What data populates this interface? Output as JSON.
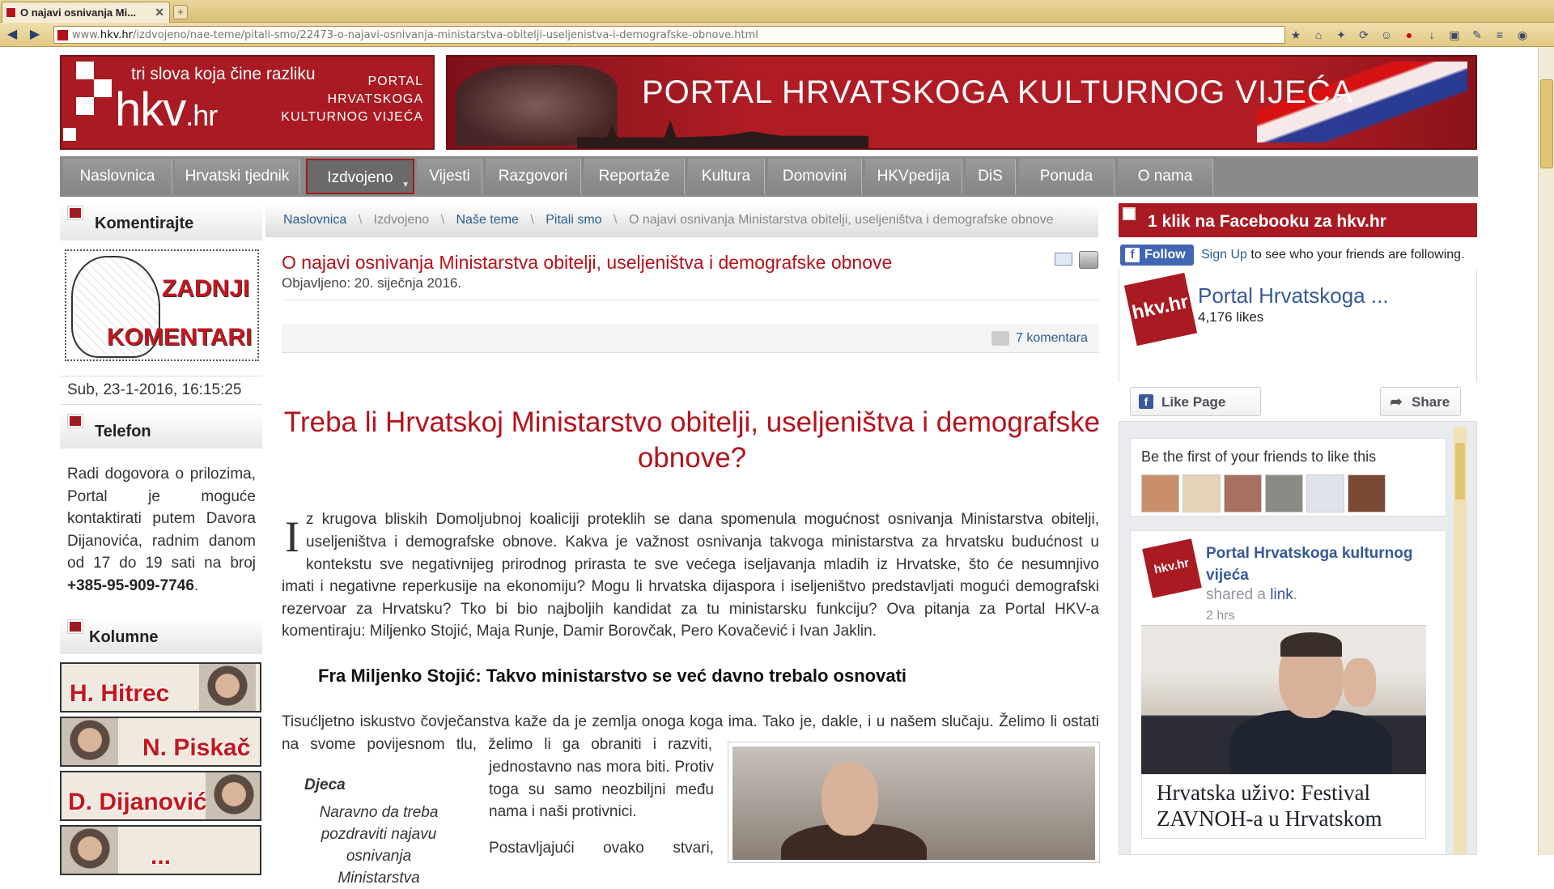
{
  "browser": {
    "tab_title": "O najavi osnivanja Mi...",
    "url_prefix": "www.",
    "url_host": "hkv.hr",
    "url_path": "/izdvojeno/nae-teme/pitali-smo/22473-o-najavi-osnivanja-ministarstva-obitelji-useljenistva-i-demografske-obnove.html"
  },
  "header": {
    "logo_tagline": "tri slova koja čine razliku",
    "logo_main": "hkv",
    "logo_tld": ".hr",
    "logo_right_1": "PORTAL",
    "logo_right_2": "HRVATSKOGA",
    "logo_right_3": "KULTURNOG VIJEĆA",
    "banner_title": "PORTAL HRVATSKOGA KULTURNOG VIJEĆA"
  },
  "menu": [
    {
      "label": "Naslovnica"
    },
    {
      "label": "Hrvatski tjednik"
    },
    {
      "label": "Izdvojeno"
    },
    {
      "label": "Vijesti"
    },
    {
      "label": "Razgovori"
    },
    {
      "label": "Reportaže"
    },
    {
      "label": "Kultura"
    },
    {
      "label": "Domovini"
    },
    {
      "label": "HKVpedija"
    },
    {
      "label": "DiS"
    },
    {
      "label": "Ponuda"
    },
    {
      "label": "O nama"
    }
  ],
  "left": {
    "comments_heading": "Komentirajte",
    "zk_1": "ZADNJI",
    "zk_2": "KOMENTARI",
    "datetime": "Sub, 23-1-2016, 16:15:25",
    "phone_heading": "Telefon",
    "phone_text": "Radi dogovora o prilozima, Portal je moguće kontaktirati putem Davora Dijanovića, radnim danom od 17 do 19 sati na broj ",
    "phone_number": "+385-95-909-7746",
    "phone_end": ".",
    "columns_heading": "Kolumne",
    "columnists": [
      "H. Hitrec",
      "N. Piskač",
      "D. Dijanović",
      "..."
    ]
  },
  "breadcrumb": {
    "home": "Naslovnica",
    "sep": "\\",
    "section": "Izdvojeno",
    "topic": "Naše teme",
    "sub": "Pitali smo",
    "current": "O najavi osnivanja Ministarstva obitelji, useljeništva i demografske obnove"
  },
  "article": {
    "title": "O najavi osnivanja Ministarstva obitelji, useljeništva i demografske obnove",
    "published": "Objavljeno: 20. siječnja 2016.",
    "comments": "7 komentara",
    "headline": "Treba li Hrvatskoj Ministarstvo obitelji, useljeništva i demografske obnove?",
    "dropcap": "I",
    "intro_line1": "z krugova bliskih Domoljubnoj koaliciji proteklih se dana spomenula mogućnost osnivanja Ministarstva obitelji,",
    "intro_line2": "useljeništva i demografske obnove. Kakva je važnost osnivanja takvoga ministarstva za hrvatsku budućnost u",
    "intro_line3": "kontekstu sve negativnijeg prirodnog prirasta te sve većega iseljavanja mladih iz Hrvatske, što će nesumnjivo",
    "intro_rest": "imati i negativne reperkusije na ekonomiju? Mogu li hrvatska dijaspora i iseljeništvo predstavljati mogući demografski rezervoar za Hrvatsku? Tko bi bio najboljih kandidat za tu ministarsku funkciju? Ova pitanja za Portal HKV-a komentiraju: Miljenko Stojić, Maja Runje, Damir Borovčak, Pero Kovačević i Ivan Jaklin.",
    "subhead": "Fra Miljenko Stojić: Takvo ministarstvo se već davno trebalo osnovati",
    "p2_line1": "Tisućljetno iskustvo čovječanstva kaže da je zemlja onoga koga ima. Tako je, dakle, i u našem slučaju. Želimo li ostati",
    "p2_line2": "na svome povijesnom tlu, želimo li ga obraniti i razviti,",
    "p2_col": "jednostavno nas mora biti. Protiv toga su samo neozbiljni među nama i naši protivnici.",
    "p3_start": "Postavljajući ovako stvari,",
    "quote_heading": "Djeca",
    "quote_text": "Naravno da treba pozdraviti najavu osnivanja Ministarstva"
  },
  "right": {
    "heading": "1 klik na Facebooku za hkv.hr",
    "follow": "Follow",
    "signup": "Sign Up",
    "follow_text": " to see who your friends are following.",
    "page_name": "Portal Hrvatskoga ...",
    "likes": "4,176 likes",
    "like_page": "Like Page",
    "share": "Share",
    "friends_title": "Be the first of your friends to like this",
    "shared_name": "Portal Hrvatskoga kulturnog vijeća",
    "shared_text": "shared a ",
    "shared_link": "link",
    "shared_end": ".",
    "shared_time": "2 hrs",
    "news_title": "Hrvatska uživo: Festival ZAVNOH-a u Hrvatskom"
  },
  "colors": {
    "brand_red": "#b5121b",
    "menu_gray": "#8a8a8a",
    "fb_blue": "#4267b2"
  }
}
